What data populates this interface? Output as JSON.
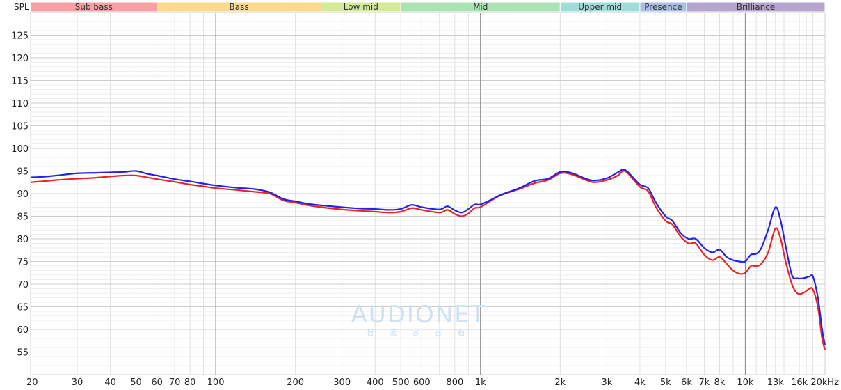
{
  "chart_data": {
    "type": "line",
    "ylabel": "SPL",
    "x_scale": "log",
    "xlim": [
      20,
      20000
    ],
    "ylim": [
      50,
      130
    ],
    "y_ticks": [
      55,
      60,
      65,
      70,
      75,
      80,
      85,
      90,
      95,
      100,
      105,
      110,
      115,
      120,
      125
    ],
    "x_ticks": [
      {
        "value": 20,
        "label": "20"
      },
      {
        "value": 30,
        "label": "30"
      },
      {
        "value": 40,
        "label": "40"
      },
      {
        "value": 50,
        "label": "50"
      },
      {
        "value": 60,
        "label": "60"
      },
      {
        "value": 70,
        "label": "70"
      },
      {
        "value": 80,
        "label": "80"
      },
      {
        "value": 100,
        "label": "100"
      },
      {
        "value": 200,
        "label": "200"
      },
      {
        "value": 300,
        "label": "300"
      },
      {
        "value": 400,
        "label": "400"
      },
      {
        "value": 500,
        "label": "500"
      },
      {
        "value": 600,
        "label": "600"
      },
      {
        "value": 800,
        "label": "800"
      },
      {
        "value": 1000,
        "label": "1k"
      },
      {
        "value": 2000,
        "label": "2k"
      },
      {
        "value": 3000,
        "label": "3k"
      },
      {
        "value": 4000,
        "label": "4k"
      },
      {
        "value": 5000,
        "label": "5k"
      },
      {
        "value": 6000,
        "label": "6k"
      },
      {
        "value": 7000,
        "label": "7k"
      },
      {
        "value": 8000,
        "label": "8k"
      },
      {
        "value": 10000,
        "label": "10k"
      },
      {
        "value": 13000,
        "label": "13k"
      },
      {
        "value": 16000,
        "label": "16k"
      },
      {
        "value": 20000,
        "label": "20kHz"
      }
    ],
    "bands": [
      {
        "label": "Sub bass",
        "from": 20,
        "to": 60,
        "color": "#f7a1a6"
      },
      {
        "label": "Bass",
        "from": 60,
        "to": 250,
        "color": "#fbd98e"
      },
      {
        "label": "Low mid",
        "from": 250,
        "to": 500,
        "color": "#d3ea99"
      },
      {
        "label": "Mid",
        "from": 500,
        "to": 2000,
        "color": "#a9e2b3"
      },
      {
        "label": "Upper mid",
        "from": 2000,
        "to": 4000,
        "color": "#9fdcda"
      },
      {
        "label": "Presence",
        "from": 4000,
        "to": 6000,
        "color": "#a9bfe8"
      },
      {
        "label": "Brilliance",
        "from": 6000,
        "to": 20000,
        "color": "#b6a5cf"
      }
    ],
    "grid": true,
    "series": [
      {
        "color": "#ee2222",
        "points": [
          [
            20,
            92.5
          ],
          [
            22,
            92.7
          ],
          [
            25,
            93.0
          ],
          [
            30,
            93.3
          ],
          [
            35,
            93.5
          ],
          [
            40,
            93.8
          ],
          [
            45,
            94.0
          ],
          [
            50,
            94.0
          ],
          [
            55,
            93.6
          ],
          [
            60,
            93.2
          ],
          [
            70,
            92.6
          ],
          [
            80,
            92.0
          ],
          [
            90,
            91.6
          ],
          [
            100,
            91.2
          ],
          [
            120,
            90.8
          ],
          [
            140,
            90.4
          ],
          [
            160,
            90.0
          ],
          [
            180,
            88.5
          ],
          [
            200,
            88.0
          ],
          [
            220,
            87.5
          ],
          [
            250,
            87.0
          ],
          [
            300,
            86.5
          ],
          [
            350,
            86.2
          ],
          [
            400,
            86.0
          ],
          [
            450,
            85.8
          ],
          [
            500,
            86.0
          ],
          [
            550,
            86.8
          ],
          [
            600,
            86.4
          ],
          [
            700,
            85.8
          ],
          [
            750,
            86.4
          ],
          [
            800,
            85.5
          ],
          [
            850,
            85.0
          ],
          [
            900,
            85.6
          ],
          [
            950,
            86.8
          ],
          [
            1000,
            87.0
          ],
          [
            1100,
            88.5
          ],
          [
            1200,
            89.7
          ],
          [
            1400,
            91.0
          ],
          [
            1600,
            92.3
          ],
          [
            1800,
            93.0
          ],
          [
            2000,
            94.5
          ],
          [
            2200,
            94.3
          ],
          [
            2500,
            93.0
          ],
          [
            2700,
            92.5
          ],
          [
            3000,
            93.0
          ],
          [
            3300,
            94.0
          ],
          [
            3450,
            95.0
          ],
          [
            3600,
            94.5
          ],
          [
            4000,
            91.5
          ],
          [
            4300,
            90.5
          ],
          [
            4600,
            87.0
          ],
          [
            5000,
            84.0
          ],
          [
            5300,
            83.2
          ],
          [
            5700,
            80.5
          ],
          [
            6100,
            79.0
          ],
          [
            6500,
            79.0
          ],
          [
            7000,
            76.5
          ],
          [
            7500,
            75.3
          ],
          [
            8000,
            76.0
          ],
          [
            8500,
            74.5
          ],
          [
            9000,
            73.0
          ],
          [
            9500,
            72.3
          ],
          [
            10000,
            72.5
          ],
          [
            10500,
            74.0
          ],
          [
            11000,
            74.0
          ],
          [
            11500,
            74.5
          ],
          [
            12200,
            77.0
          ],
          [
            13000,
            82.3
          ],
          [
            13600,
            80.0
          ],
          [
            14200,
            75.0
          ],
          [
            15000,
            70.0
          ],
          [
            15700,
            68.0
          ],
          [
            16500,
            68.0
          ],
          [
            17500,
            69.0
          ],
          [
            18000,
            68.8
          ],
          [
            18800,
            65.0
          ],
          [
            19500,
            58.0
          ],
          [
            20000,
            55.5
          ]
        ]
      },
      {
        "color": "#2222ee",
        "points": [
          [
            20,
            93.6
          ],
          [
            22,
            93.7
          ],
          [
            25,
            94.0
          ],
          [
            30,
            94.5
          ],
          [
            35,
            94.6
          ],
          [
            40,
            94.7
          ],
          [
            45,
            94.8
          ],
          [
            50,
            95.0
          ],
          [
            55,
            94.4
          ],
          [
            60,
            94.0
          ],
          [
            70,
            93.2
          ],
          [
            80,
            92.7
          ],
          [
            90,
            92.2
          ],
          [
            100,
            91.8
          ],
          [
            120,
            91.3
          ],
          [
            140,
            91.0
          ],
          [
            160,
            90.3
          ],
          [
            180,
            88.8
          ],
          [
            200,
            88.3
          ],
          [
            220,
            87.8
          ],
          [
            250,
            87.4
          ],
          [
            300,
            87.0
          ],
          [
            350,
            86.7
          ],
          [
            400,
            86.6
          ],
          [
            450,
            86.4
          ],
          [
            500,
            86.6
          ],
          [
            550,
            87.5
          ],
          [
            600,
            87.0
          ],
          [
            700,
            86.5
          ],
          [
            750,
            87.2
          ],
          [
            800,
            86.3
          ],
          [
            850,
            85.8
          ],
          [
            900,
            86.6
          ],
          [
            950,
            87.6
          ],
          [
            1000,
            87.6
          ],
          [
            1100,
            88.7
          ],
          [
            1200,
            89.8
          ],
          [
            1400,
            91.2
          ],
          [
            1600,
            92.8
          ],
          [
            1800,
            93.3
          ],
          [
            2000,
            94.8
          ],
          [
            2200,
            94.6
          ],
          [
            2500,
            93.3
          ],
          [
            2700,
            92.9
          ],
          [
            3000,
            93.4
          ],
          [
            3300,
            94.7
          ],
          [
            3450,
            95.3
          ],
          [
            3600,
            94.8
          ],
          [
            4000,
            92.0
          ],
          [
            4300,
            91.2
          ],
          [
            4600,
            88.0
          ],
          [
            5000,
            85.0
          ],
          [
            5300,
            84.0
          ],
          [
            5700,
            81.3
          ],
          [
            6100,
            80.0
          ],
          [
            6500,
            80.0
          ],
          [
            7000,
            78.0
          ],
          [
            7500,
            77.0
          ],
          [
            8000,
            77.6
          ],
          [
            8500,
            76.0
          ],
          [
            9000,
            75.3
          ],
          [
            9500,
            75.0
          ],
          [
            10000,
            75.0
          ],
          [
            10500,
            76.5
          ],
          [
            11000,
            76.7
          ],
          [
            11500,
            78.0
          ],
          [
            12200,
            82.0
          ],
          [
            13000,
            87.0
          ],
          [
            13600,
            84.0
          ],
          [
            14200,
            78.5
          ],
          [
            15000,
            72.0
          ],
          [
            15700,
            71.3
          ],
          [
            16500,
            71.3
          ],
          [
            17500,
            71.7
          ],
          [
            18000,
            71.7
          ],
          [
            18800,
            67.0
          ],
          [
            19500,
            60.0
          ],
          [
            20000,
            56.5
          ]
        ]
      }
    ],
    "watermark": {
      "text": "AUDIONET",
      "subtext": "普 诺 客 音 箱"
    }
  }
}
